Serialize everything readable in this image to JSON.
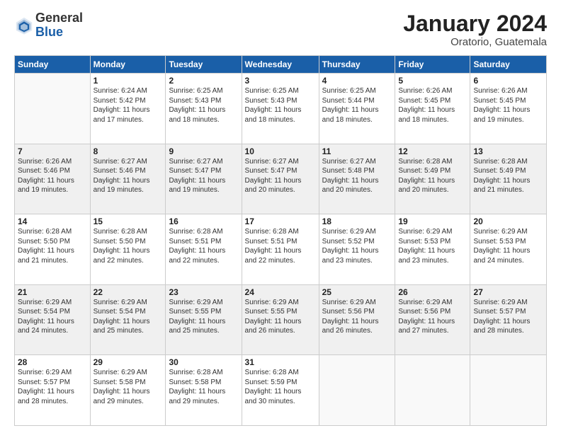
{
  "logo": {
    "general": "General",
    "blue": "Blue"
  },
  "header": {
    "month": "January 2024",
    "location": "Oratorio, Guatemala"
  },
  "weekdays": [
    "Sunday",
    "Monday",
    "Tuesday",
    "Wednesday",
    "Thursday",
    "Friday",
    "Saturday"
  ],
  "weeks": [
    [
      {
        "day": "",
        "info": ""
      },
      {
        "day": "1",
        "info": "Sunrise: 6:24 AM\nSunset: 5:42 PM\nDaylight: 11 hours\nand 17 minutes."
      },
      {
        "day": "2",
        "info": "Sunrise: 6:25 AM\nSunset: 5:43 PM\nDaylight: 11 hours\nand 18 minutes."
      },
      {
        "day": "3",
        "info": "Sunrise: 6:25 AM\nSunset: 5:43 PM\nDaylight: 11 hours\nand 18 minutes."
      },
      {
        "day": "4",
        "info": "Sunrise: 6:25 AM\nSunset: 5:44 PM\nDaylight: 11 hours\nand 18 minutes."
      },
      {
        "day": "5",
        "info": "Sunrise: 6:26 AM\nSunset: 5:45 PM\nDaylight: 11 hours\nand 18 minutes."
      },
      {
        "day": "6",
        "info": "Sunrise: 6:26 AM\nSunset: 5:45 PM\nDaylight: 11 hours\nand 19 minutes."
      }
    ],
    [
      {
        "day": "7",
        "info": "Sunrise: 6:26 AM\nSunset: 5:46 PM\nDaylight: 11 hours\nand 19 minutes."
      },
      {
        "day": "8",
        "info": "Sunrise: 6:27 AM\nSunset: 5:46 PM\nDaylight: 11 hours\nand 19 minutes."
      },
      {
        "day": "9",
        "info": "Sunrise: 6:27 AM\nSunset: 5:47 PM\nDaylight: 11 hours\nand 19 minutes."
      },
      {
        "day": "10",
        "info": "Sunrise: 6:27 AM\nSunset: 5:47 PM\nDaylight: 11 hours\nand 20 minutes."
      },
      {
        "day": "11",
        "info": "Sunrise: 6:27 AM\nSunset: 5:48 PM\nDaylight: 11 hours\nand 20 minutes."
      },
      {
        "day": "12",
        "info": "Sunrise: 6:28 AM\nSunset: 5:49 PM\nDaylight: 11 hours\nand 20 minutes."
      },
      {
        "day": "13",
        "info": "Sunrise: 6:28 AM\nSunset: 5:49 PM\nDaylight: 11 hours\nand 21 minutes."
      }
    ],
    [
      {
        "day": "14",
        "info": "Sunrise: 6:28 AM\nSunset: 5:50 PM\nDaylight: 11 hours\nand 21 minutes."
      },
      {
        "day": "15",
        "info": "Sunrise: 6:28 AM\nSunset: 5:50 PM\nDaylight: 11 hours\nand 22 minutes."
      },
      {
        "day": "16",
        "info": "Sunrise: 6:28 AM\nSunset: 5:51 PM\nDaylight: 11 hours\nand 22 minutes."
      },
      {
        "day": "17",
        "info": "Sunrise: 6:28 AM\nSunset: 5:51 PM\nDaylight: 11 hours\nand 22 minutes."
      },
      {
        "day": "18",
        "info": "Sunrise: 6:29 AM\nSunset: 5:52 PM\nDaylight: 11 hours\nand 23 minutes."
      },
      {
        "day": "19",
        "info": "Sunrise: 6:29 AM\nSunset: 5:53 PM\nDaylight: 11 hours\nand 23 minutes."
      },
      {
        "day": "20",
        "info": "Sunrise: 6:29 AM\nSunset: 5:53 PM\nDaylight: 11 hours\nand 24 minutes."
      }
    ],
    [
      {
        "day": "21",
        "info": "Sunrise: 6:29 AM\nSunset: 5:54 PM\nDaylight: 11 hours\nand 24 minutes."
      },
      {
        "day": "22",
        "info": "Sunrise: 6:29 AM\nSunset: 5:54 PM\nDaylight: 11 hours\nand 25 minutes."
      },
      {
        "day": "23",
        "info": "Sunrise: 6:29 AM\nSunset: 5:55 PM\nDaylight: 11 hours\nand 25 minutes."
      },
      {
        "day": "24",
        "info": "Sunrise: 6:29 AM\nSunset: 5:55 PM\nDaylight: 11 hours\nand 26 minutes."
      },
      {
        "day": "25",
        "info": "Sunrise: 6:29 AM\nSunset: 5:56 PM\nDaylight: 11 hours\nand 26 minutes."
      },
      {
        "day": "26",
        "info": "Sunrise: 6:29 AM\nSunset: 5:56 PM\nDaylight: 11 hours\nand 27 minutes."
      },
      {
        "day": "27",
        "info": "Sunrise: 6:29 AM\nSunset: 5:57 PM\nDaylight: 11 hours\nand 28 minutes."
      }
    ],
    [
      {
        "day": "28",
        "info": "Sunrise: 6:29 AM\nSunset: 5:57 PM\nDaylight: 11 hours\nand 28 minutes."
      },
      {
        "day": "29",
        "info": "Sunrise: 6:29 AM\nSunset: 5:58 PM\nDaylight: 11 hours\nand 29 minutes."
      },
      {
        "day": "30",
        "info": "Sunrise: 6:28 AM\nSunset: 5:58 PM\nDaylight: 11 hours\nand 29 minutes."
      },
      {
        "day": "31",
        "info": "Sunrise: 6:28 AM\nSunset: 5:59 PM\nDaylight: 11 hours\nand 30 minutes."
      },
      {
        "day": "",
        "info": ""
      },
      {
        "day": "",
        "info": ""
      },
      {
        "day": "",
        "info": ""
      }
    ]
  ]
}
